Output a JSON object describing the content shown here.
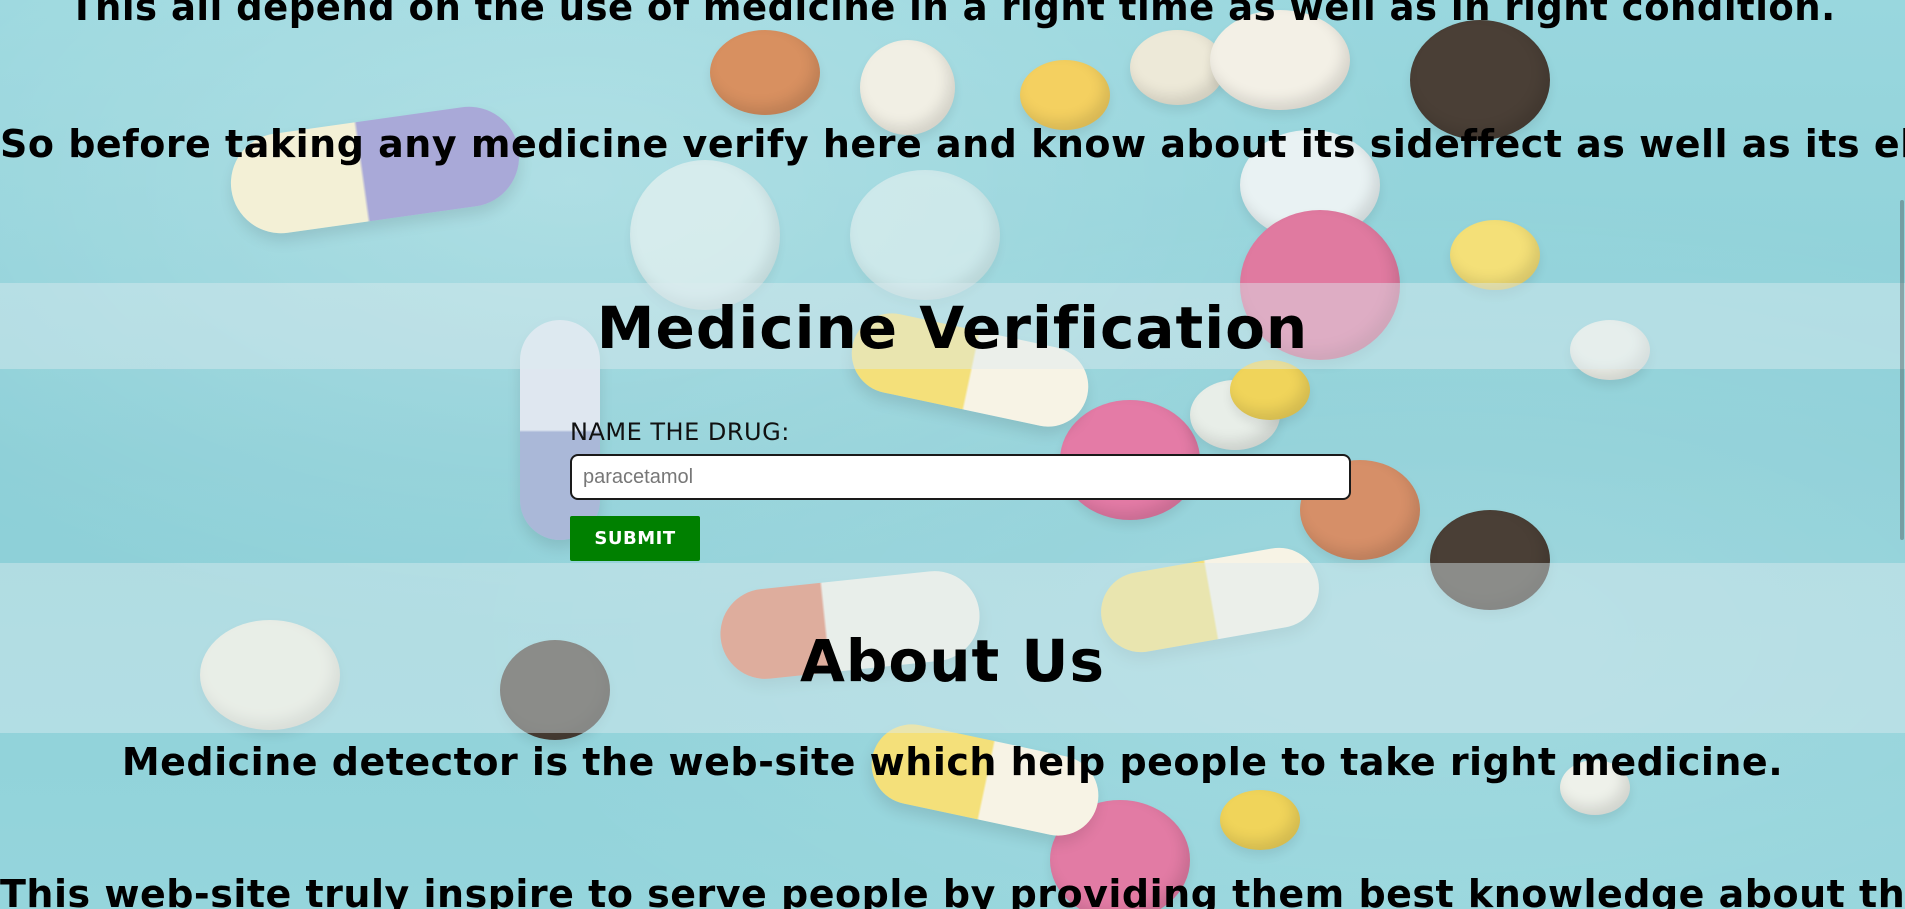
{
  "intro": {
    "line1": "This all depend on the use of medicine in a right time as well as in right condition.",
    "line2": "So before taking any medicine verify here and know about its sideffect as well as its eligibility."
  },
  "verification": {
    "title": "Medicine Verification",
    "label": "NAME THE DRUG:",
    "input_placeholder": "paracetamol",
    "input_value": "",
    "submit_label": "SUBMIT"
  },
  "about": {
    "title": "About Us",
    "line1": "Medicine detector is the web-site which help people to take right medicine.",
    "line2": "This web-site truly inspire to serve people by providing them best knowledge about the medicine."
  },
  "colors": {
    "background": "#8fd0d8",
    "submit_button": "#008000",
    "text": "#000000"
  }
}
